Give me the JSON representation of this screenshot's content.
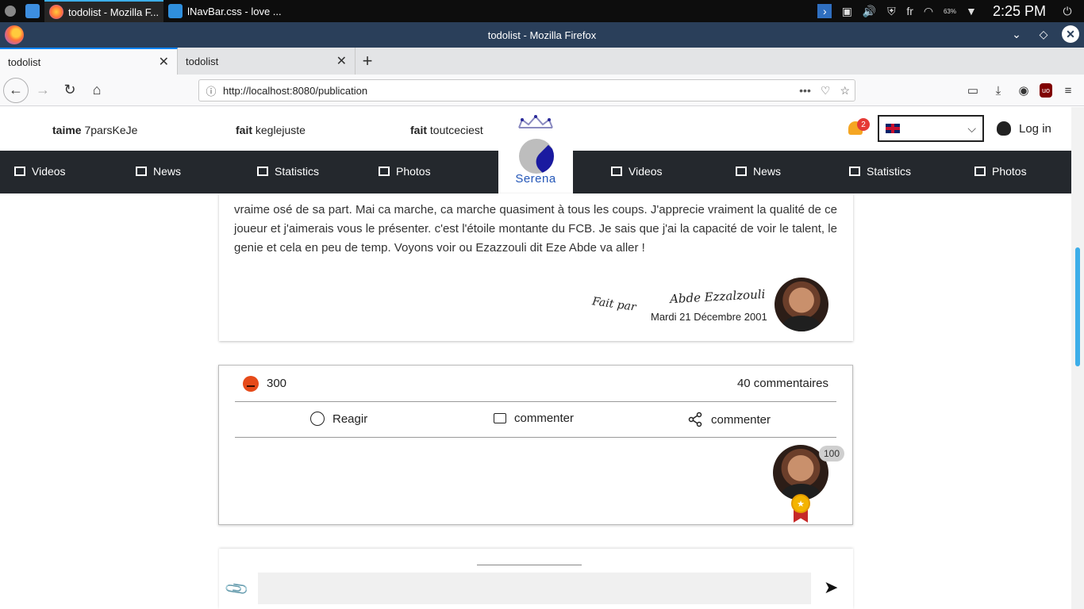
{
  "taskbar": {
    "apps": [
      {
        "label": "todolist - Mozilla F...",
        "icon": "firefox-icon"
      },
      {
        "label": "lNavBar.css - love ...",
        "icon": "vscode-icon"
      }
    ],
    "tray": {
      "keyboard_layout": "fr",
      "battery_percent": "63%",
      "clock": "2:25 PM"
    }
  },
  "browser": {
    "window_title": "todolist - Mozilla Firefox",
    "tabs": [
      {
        "label": "todolist",
        "active": true
      },
      {
        "label": "todolist",
        "active": false
      }
    ],
    "url": "http://localhost:8080/publication"
  },
  "site": {
    "ticker": [
      {
        "verb": "taime",
        "name": "7parsKeJe"
      },
      {
        "verb": "fait",
        "name": "keglejuste"
      },
      {
        "verb": "fait",
        "name": "toutceciest"
      }
    ],
    "logo_text": "Serena",
    "notification_count": "2",
    "login_label": "Log in",
    "menu_left": [
      "Videos",
      "News",
      "Statistics",
      "Photos"
    ],
    "menu_right": [
      "Videos",
      "News",
      "Statistics",
      "Photos"
    ]
  },
  "article": {
    "text": "vraime osé de sa part. Mai ca marche, ca marche quasiment à tous les coups. J'apprecie vraiment la qualité de ce joueur et j'aimerais vous le présenter. c'est l'étoile montante du FCB. Je sais que j'ai la capacité de voir le talent, le genie et cela en peu de temp. Voyons voir ou Ezazzouli dit Eze Abde va aller !",
    "fait_par": "Fait par",
    "author": "Abde Ezzalzouli",
    "date": "Mardi 21 Décembre 2001"
  },
  "reactions": {
    "count": "300",
    "comments_count": "40 commentaires",
    "react_label": "Reagir",
    "comment_label": "commenter",
    "share_label": "commenter",
    "badge_value": "100"
  },
  "composer": {
    "placeholder": ""
  },
  "colors": {
    "menu_bg": "#24282d",
    "logo_blue": "#2457b8",
    "titlebar": "#2a3f5a",
    "accent": "#3daee9"
  }
}
